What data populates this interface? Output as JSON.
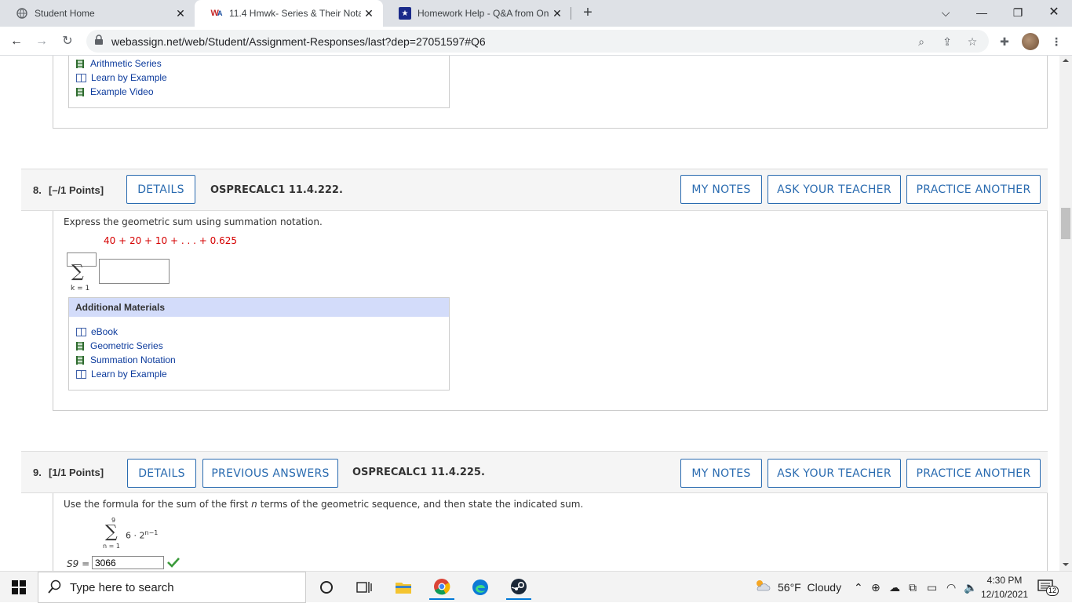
{
  "browser": {
    "tabs": [
      {
        "title": "Student Home",
        "active": false
      },
      {
        "title": "11.4 Hmwk- Series & Their Notat",
        "active": true
      },
      {
        "title": "Homework Help - Q&A from Onl",
        "active": false
      }
    ],
    "url": "webassign.net/web/Student/Assignment-Responses/last?dep=27051597#Q6"
  },
  "top_materials": {
    "items": [
      {
        "label": "Arithmetic Series",
        "icon": "film-icon"
      },
      {
        "label": "Learn by Example",
        "icon": "book-icon"
      },
      {
        "label": "Example Video",
        "icon": "film-icon"
      }
    ]
  },
  "q8": {
    "number": "8.",
    "points": "[–/1 Points]",
    "details_label": "DETAILS",
    "code": "OSPRECALC1 11.4.222.",
    "my_notes_label": "MY NOTES",
    "ask_teacher_label": "ASK YOUR TEACHER",
    "practice_label": "PRACTICE ANOTHER",
    "prompt": "Express the geometric sum using summation notation.",
    "expression": "40 + 20 + 10 + . . . + 0.625",
    "sigma_lower": "k = 1",
    "materials_title": "Additional Materials",
    "materials": [
      {
        "label": "eBook",
        "icon": "book-icon"
      },
      {
        "label": "Geometric Series",
        "icon": "film-icon"
      },
      {
        "label": "Summation Notation",
        "icon": "film-icon"
      },
      {
        "label": "Learn by Example",
        "icon": "book-icon"
      }
    ]
  },
  "q9": {
    "number": "9.",
    "points": "[1/1 Points]",
    "details_label": "DETAILS",
    "previous_label": "PREVIOUS ANSWERS",
    "code": "OSPRECALC1 11.4.225.",
    "my_notes_label": "MY NOTES",
    "ask_teacher_label": "ASK YOUR TEACHER",
    "practice_label": "PRACTICE ANOTHER",
    "prompt_before": "Use the formula for the sum of the first ",
    "prompt_var": "n",
    "prompt_after": " terms of the geometric sequence, and then state the indicated sum.",
    "sigma_upper": "9",
    "sigma_lower": "n = 1",
    "term_base": "6 · 2",
    "term_exp": "n−1",
    "answer_label": "S9 =",
    "answer_value": "3066"
  },
  "taskbar": {
    "search_placeholder": "Type here to search",
    "weather": "56°F  Cloudy",
    "time": "4:30 PM",
    "date": "12/10/2021",
    "notifications": "12"
  },
  "colors": {
    "accent": "#2a6bb0",
    "red_expression": "#d50000",
    "materials_header": "#d3dcfa",
    "check": "#3a9a3a"
  }
}
